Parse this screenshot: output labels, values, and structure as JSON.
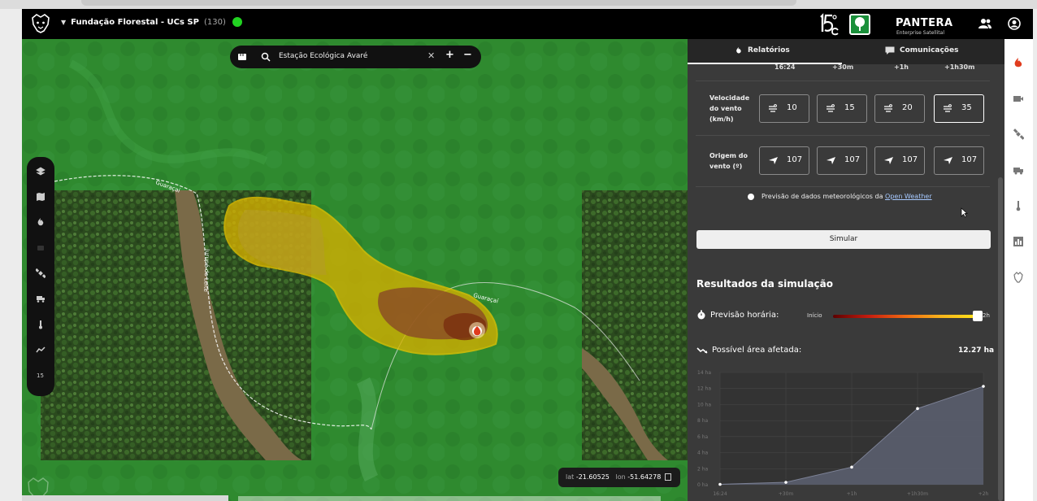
{
  "header": {
    "org_name": "Fundação Florestal - UCs SP",
    "org_count": "(130)",
    "brand_15c": "15c",
    "brand_name": "PANTERA",
    "brand_sub": "Enterprise Satellital"
  },
  "search": {
    "query": "Estação Ecológica Avaré"
  },
  "map": {
    "road_name_1": "Guaraçaí",
    "road_name_2": "Guaraçaí",
    "road_name_3": "Jurupé do Leite",
    "coords": {
      "lat_label": "lat",
      "lat": "-21.60525",
      "lon_label": "lon",
      "lon": "-51.64278"
    }
  },
  "left_tools": [
    "layers-icon",
    "map-icon",
    "fire-icon",
    "blank-icon",
    "satellite-icon",
    "truck-icon",
    "thermometer-icon",
    "trend-icon",
    "15c-icon"
  ],
  "panel": {
    "tabs": [
      {
        "label": "Relatórios",
        "active": true
      },
      {
        "label": "Comunicações",
        "active": false
      }
    ],
    "time_columns": [
      "16:24",
      "+30m",
      "+1h",
      "+1h30m"
    ],
    "wind_speed": {
      "label_lines": [
        "Velocidade",
        "do vento",
        "(km/h)"
      ],
      "values": [
        "10",
        "15",
        "20",
        "35"
      ],
      "selected_index": 3
    },
    "wind_origin": {
      "label_lines": [
        "Origem do",
        "vento (º)"
      ],
      "values": [
        "107",
        "107",
        "107",
        "107"
      ]
    },
    "weather_note": "Previsão de dados meteorológicos da",
    "weather_link": "Open Weather",
    "simulate_label": "Simular",
    "results_title": "Resultados da simulação",
    "forecast_label": "Previsão horária:",
    "slider_start": "Início",
    "slider_end": "2h",
    "slider_value": 1.0,
    "area_label": "Possível área afetada:",
    "area_value": "12.27 ha"
  },
  "chart_data": {
    "type": "area",
    "x": [
      "16:24",
      "+30m",
      "+1h",
      "+1h30m",
      "+2h"
    ],
    "y_ticks": [
      "0 ha",
      "2 ha",
      "4 ha",
      "6 ha",
      "8 ha",
      "10 ha",
      "12 ha",
      "14 ha"
    ],
    "ylim": [
      0,
      14
    ],
    "values": [
      0.05,
      0.3,
      2.2,
      9.5,
      12.27
    ],
    "series_color": "#5a5e6e",
    "point_color": "#ffffff"
  },
  "right_rail": [
    "fire-icon",
    "video-icon",
    "satellite-icon",
    "truck-icon",
    "thermometer-icon",
    "chart-icon",
    "panther-icon"
  ],
  "colors": {
    "accent_fire": "#e03c1e",
    "status_green": "#21d321",
    "panel_bg": "#3a3a3a"
  }
}
